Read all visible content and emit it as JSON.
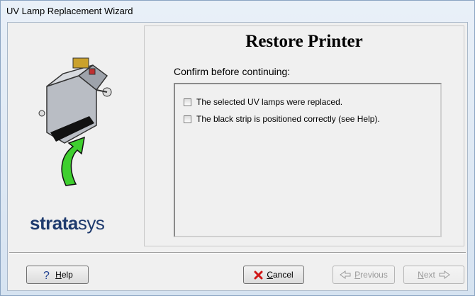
{
  "window": {
    "title": "UV Lamp Replacement Wizard"
  },
  "branding": {
    "logo_bold": "strata",
    "logo_light": "sys"
  },
  "page": {
    "heading": "Restore Printer",
    "prompt": "Confirm before continuing:",
    "checks": [
      {
        "label": "The selected UV lamps were replaced.",
        "checked": false
      },
      {
        "label": "The black strip is positioned correctly (see Help).",
        "checked": false
      }
    ]
  },
  "buttons": {
    "help": {
      "mnemonic": "H",
      "rest": "elp"
    },
    "cancel": {
      "mnemonic": "C",
      "rest": "ancel"
    },
    "previous": {
      "mnemonic": "P",
      "rest": "revious"
    },
    "next": {
      "mnemonic": "N",
      "rest": "ext"
    }
  },
  "colors": {
    "logo": "#1f3b6e",
    "arrow": "#3fcf2f",
    "cancel_x": "#d01818"
  },
  "icons": {
    "help": "question-mark-icon",
    "cancel": "red-x-icon",
    "previous": "previous-arrow-icon",
    "next": "next-arrow-icon"
  }
}
